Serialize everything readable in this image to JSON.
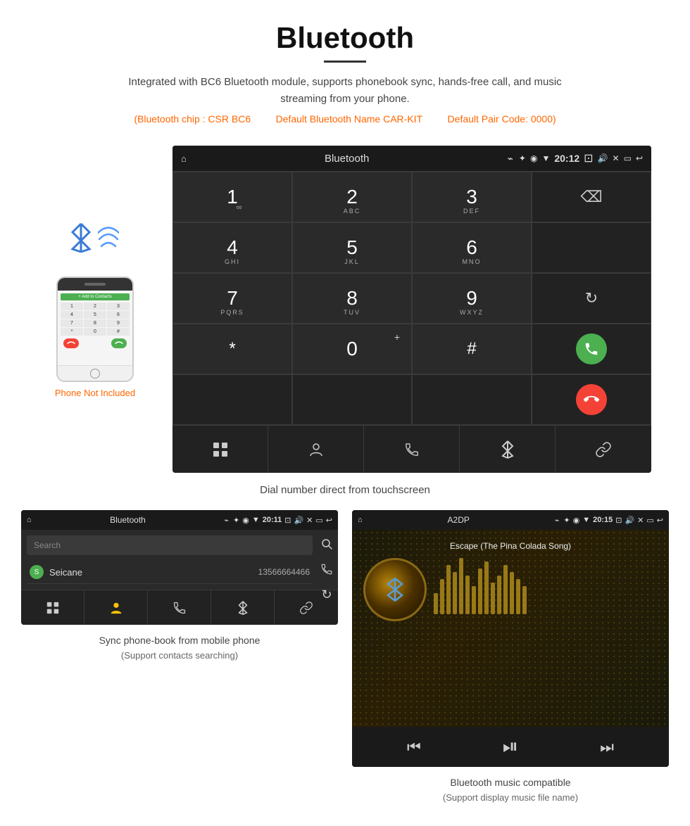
{
  "header": {
    "title": "Bluetooth",
    "description": "Integrated with BC6 Bluetooth module, supports phonebook sync, hands-free call, and music streaming from your phone.",
    "specs": {
      "chip": "(Bluetooth chip : CSR BC6",
      "name": "Default Bluetooth Name CAR-KIT",
      "code": "Default Pair Code: 0000)"
    }
  },
  "dial_screen": {
    "status_bar": {
      "home_icon": "⌂",
      "title": "Bluetooth",
      "usb_icon": "⌁",
      "bt_icon": "✦",
      "location_icon": "◉",
      "signal_icon": "▼",
      "time": "20:12",
      "camera_icon": "📷",
      "volume_icon": "🔊",
      "x_icon": "✕",
      "rect_icon": "▭",
      "back_icon": "↩"
    },
    "keys": [
      {
        "number": "1",
        "letters": "∞",
        "sub": ""
      },
      {
        "number": "2",
        "letters": "ABC",
        "sub": ""
      },
      {
        "number": "3",
        "letters": "DEF",
        "sub": ""
      },
      {
        "number": "",
        "letters": "",
        "sub": "backspace"
      },
      {
        "number": "4",
        "letters": "GHI",
        "sub": ""
      },
      {
        "number": "5",
        "letters": "JKL",
        "sub": ""
      },
      {
        "number": "6",
        "letters": "MNO",
        "sub": ""
      },
      {
        "number": "",
        "letters": "",
        "sub": "empty"
      },
      {
        "number": "7",
        "letters": "PQRS",
        "sub": ""
      },
      {
        "number": "8",
        "letters": "TUV",
        "sub": ""
      },
      {
        "number": "9",
        "letters": "WXYZ",
        "sub": ""
      },
      {
        "number": "",
        "letters": "",
        "sub": "refresh"
      },
      {
        "number": "*",
        "letters": "",
        "sub": "star"
      },
      {
        "number": "0",
        "letters": "+",
        "sub": "zero"
      },
      {
        "number": "#",
        "letters": "",
        "sub": "hash"
      },
      {
        "number": "",
        "letters": "",
        "sub": "call-green"
      },
      {
        "number": "",
        "letters": "",
        "sub": "call-red"
      }
    ],
    "bottom_icons": [
      "grid",
      "person",
      "phone",
      "bluetooth",
      "link"
    ],
    "caption": "Dial number direct from touchscreen"
  },
  "phone_mockup": {
    "add_contacts": "+ Add to Contacts",
    "not_included": "Phone Not Included",
    "keys_mini": [
      "1",
      "2",
      "3",
      "4",
      "5",
      "6",
      "7",
      "8",
      "9",
      "*",
      "0",
      "#"
    ]
  },
  "phonebook_screen": {
    "status_bar": {
      "title": "Bluetooth",
      "time": "20:11"
    },
    "search_placeholder": "Search",
    "contacts": [
      {
        "letter": "S",
        "name": "Seicane",
        "number": "13566664466"
      }
    ],
    "bottom_icons": [
      "grid",
      "person-active",
      "phone",
      "bluetooth",
      "link"
    ],
    "caption": "Sync phone-book from mobile phone",
    "caption_sub": "(Support contacts searching)"
  },
  "music_screen": {
    "status_bar": {
      "title": "A2DP",
      "time": "20:15"
    },
    "song_title": "Escape (The Pina Colada Song)",
    "eq_bars": [
      30,
      50,
      70,
      60,
      80,
      55,
      40,
      65,
      75,
      45,
      55,
      70,
      60,
      50,
      40
    ],
    "controls": [
      "prev",
      "play-pause",
      "next"
    ],
    "caption": "Bluetooth music compatible",
    "caption_sub": "(Support display music file name)"
  }
}
